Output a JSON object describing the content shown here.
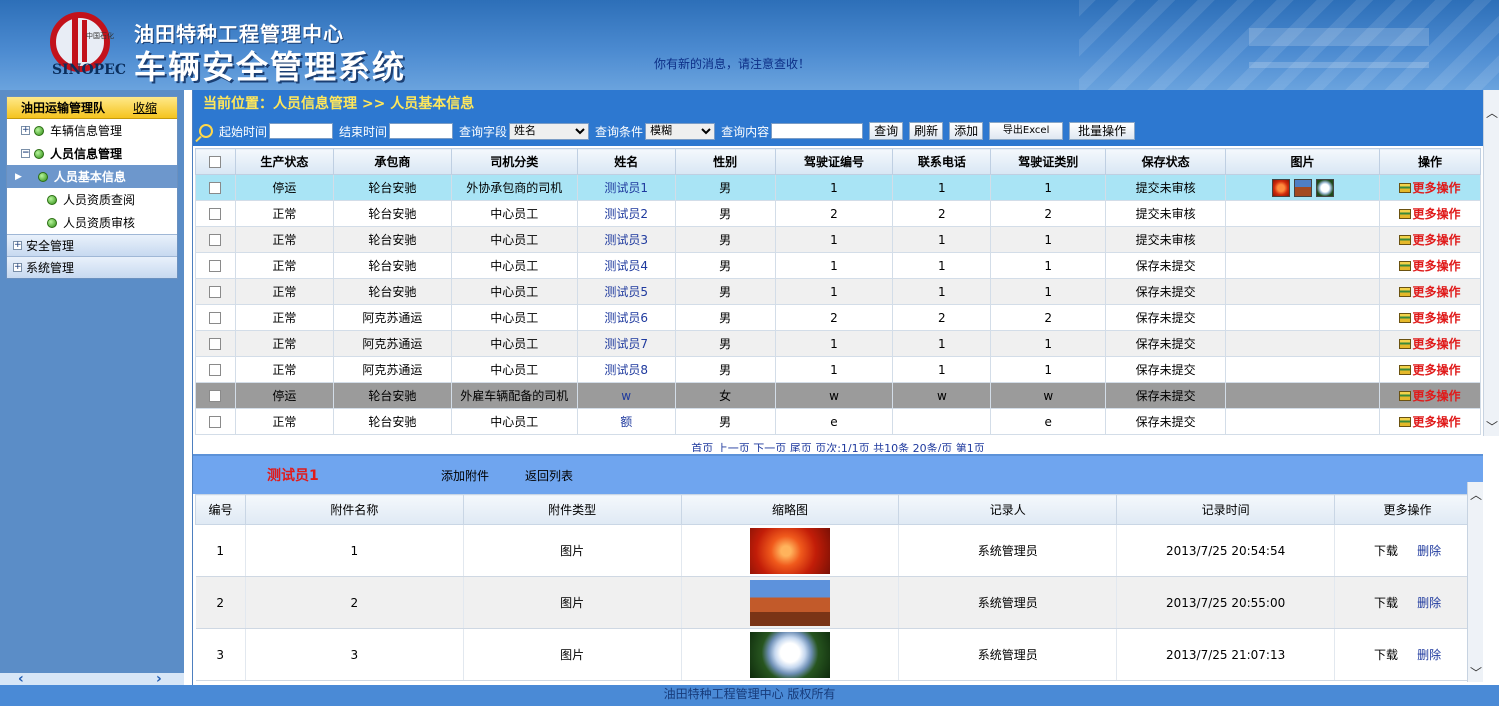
{
  "header": {
    "logo_text": "SINOPEC",
    "subtitle": "油田特种工程管理中心",
    "title": "车辆安全管理系统",
    "message": "你有新的消息，请注意查收！"
  },
  "sidebar": {
    "team": "油田运输管理队",
    "collapse": "收缩",
    "items": [
      {
        "label": "车辆信息管理"
      },
      {
        "label": "人员信息管理"
      },
      {
        "label": "人员基本信息"
      },
      {
        "label": "人员资质查阅"
      },
      {
        "label": "人员资质审核"
      }
    ],
    "groups": [
      {
        "label": "安全管理"
      },
      {
        "label": "系统管理"
      }
    ]
  },
  "breadcrumb": "当前位置：人员信息管理 >> 人员基本信息",
  "search": {
    "start_label": "起始时间",
    "end_label": "结束时间",
    "field_label": "查询字段",
    "field_value": "姓名",
    "cond_label": "查询条件",
    "cond_value": "模糊",
    "content_label": "查询内容",
    "btn_query": "查询",
    "btn_refresh": "刷新",
    "btn_add": "添加",
    "btn_export": "导出Excel",
    "btn_batch": "批量操作"
  },
  "table": {
    "headers": [
      "生产状态",
      "承包商",
      "司机分类",
      "姓名",
      "性别",
      "驾驶证编号",
      "联系电话",
      "驾驶证类别",
      "保存状态",
      "图片",
      "操作"
    ],
    "rows": [
      [
        "停运",
        "轮台安驰",
        "外协承包商的司机",
        "测试员1",
        "男",
        "1",
        "1",
        "1",
        "提交未审核",
        "",
        "更多操作"
      ],
      [
        "正常",
        "轮台安驰",
        "中心员工",
        "测试员2",
        "男",
        "2",
        "2",
        "2",
        "提交未审核",
        "",
        "更多操作"
      ],
      [
        "正常",
        "轮台安驰",
        "中心员工",
        "测试员3",
        "男",
        "1",
        "1",
        "1",
        "提交未审核",
        "",
        "更多操作"
      ],
      [
        "正常",
        "轮台安驰",
        "中心员工",
        "测试员4",
        "男",
        "1",
        "1",
        "1",
        "保存未提交",
        "",
        "更多操作"
      ],
      [
        "正常",
        "轮台安驰",
        "中心员工",
        "测试员5",
        "男",
        "1",
        "1",
        "1",
        "保存未提交",
        "",
        "更多操作"
      ],
      [
        "正常",
        "阿克苏通运",
        "中心员工",
        "测试员6",
        "男",
        "2",
        "2",
        "2",
        "保存未提交",
        "",
        "更多操作"
      ],
      [
        "正常",
        "阿克苏通运",
        "中心员工",
        "测试员7",
        "男",
        "1",
        "1",
        "1",
        "保存未提交",
        "",
        "更多操作"
      ],
      [
        "正常",
        "阿克苏通运",
        "中心员工",
        "测试员8",
        "男",
        "1",
        "1",
        "1",
        "保存未提交",
        "",
        "更多操作"
      ],
      [
        "停运",
        "轮台安驰",
        "外雇车辆配备的司机",
        "w",
        "女",
        "w",
        "w",
        "w",
        "保存未提交",
        "",
        "更多操作"
      ],
      [
        "正常",
        "轮台安驰",
        "中心员工",
        "额",
        "男",
        "e",
        "",
        "e",
        "保存未提交",
        "",
        "更多操作"
      ]
    ]
  },
  "pager": "首页  上一页  下一页  尾页  页次:1/1页 共10条 20条/页  第1页",
  "detail": {
    "name": "测试员1",
    "add_attachment": "添加附件",
    "back": "返回列表",
    "headers": [
      "编号",
      "附件名称",
      "附件类型",
      "缩略图",
      "记录人",
      "记录时间",
      "更多操作"
    ],
    "rows": [
      {
        "id": "1",
        "name": "1",
        "type": "图片",
        "recorder": "系统管理员",
        "time": "2013/7/25  20:54:54",
        "download": "下载",
        "delete": "删除"
      },
      {
        "id": "2",
        "name": "2",
        "type": "图片",
        "recorder": "系统管理员",
        "time": "2013/7/25  20:55:00",
        "download": "下载",
        "delete": "删除"
      },
      {
        "id": "3",
        "name": "3",
        "type": "图片",
        "recorder": "系统管理员",
        "time": "2013/7/25  21:07:13",
        "download": "下载",
        "delete": "删除"
      }
    ]
  },
  "footer": "油田特种工程管理中心   版权所有"
}
